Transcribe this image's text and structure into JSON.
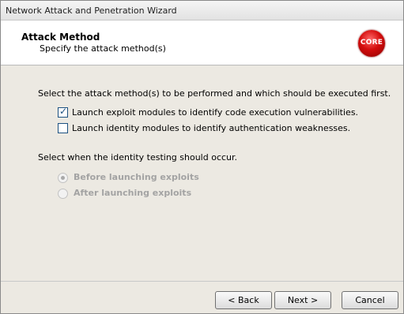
{
  "window": {
    "title": "Network Attack and Penetration Wizard"
  },
  "header": {
    "title": "Attack Method",
    "subtitle": "Specify the attack method(s)",
    "logo_text": "CORE"
  },
  "content": {
    "instruction": "Select the attack method(s) to be performed and which should be executed first.",
    "options": [
      {
        "label": "Launch exploit modules to identify code execution vulnerabilities.",
        "checked": true
      },
      {
        "label": "Launch identity modules to identify authentication weaknesses.",
        "checked": false
      }
    ],
    "timing_prompt": "Select when the identity testing should occur.",
    "timing_options": [
      {
        "label": "Before launching exploits",
        "selected": true,
        "enabled": false
      },
      {
        "label": "After launching exploits",
        "selected": false,
        "enabled": false
      }
    ]
  },
  "buttons": {
    "back": "< Back",
    "next": "Next >",
    "cancel": "Cancel"
  },
  "colors": {
    "logo": "#d40d0d",
    "disabled_text": "#a3a3a3",
    "check": "#1c5180"
  },
  "icons": {
    "logo": "core-logo-icon",
    "check": "checkmark-icon"
  }
}
